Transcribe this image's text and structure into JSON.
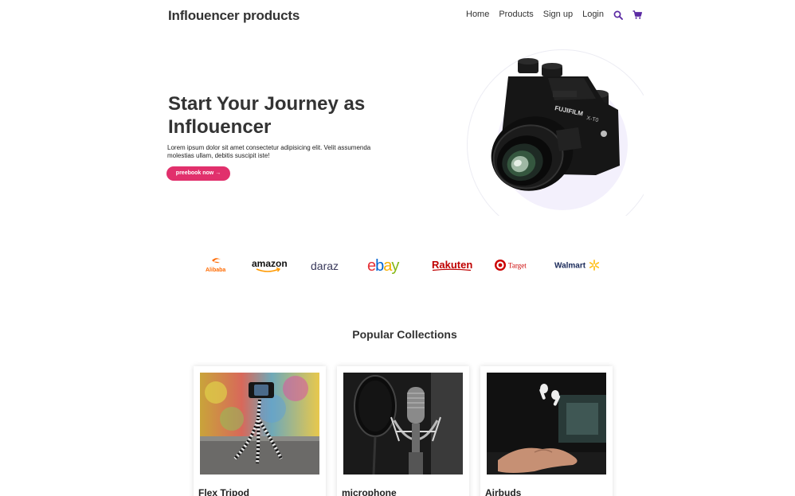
{
  "brand": "Inflouencer products",
  "nav": {
    "links": [
      "Home",
      "Products",
      "Sign up",
      "Login"
    ],
    "icons": [
      "search-icon",
      "cart-icon"
    ],
    "accent": "#5b2aa3"
  },
  "hero": {
    "title_line1": "Start Your Journey as",
    "title_line2": "Inflouencer",
    "text": "Lorem ipsum dolor sit amet consectetur adipisicing elit. Velit assumenda molestias ullam, debitis suscipit iste!",
    "cta": "preebook now →",
    "cta_color": "#e1306c",
    "camera_brand": "FUJIFILM",
    "camera_model": "X-T0"
  },
  "partners": {
    "alibaba": "Alibaba",
    "amazon": "amazon",
    "daraz": "daraz",
    "ebay": [
      "e",
      "b",
      "a",
      "y"
    ],
    "rakuten": "Rakuten",
    "target": "Target",
    "walmart": "Walmart"
  },
  "collections": {
    "title": "Popular Collections",
    "items": [
      {
        "name": "Flex Tripod"
      },
      {
        "name": "microphone"
      },
      {
        "name": "Airbuds"
      }
    ]
  }
}
